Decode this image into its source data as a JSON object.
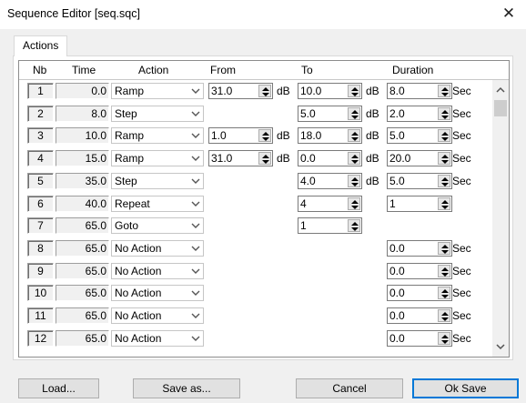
{
  "window": {
    "title": "Sequence Editor [seq.sqc]",
    "close_glyph": "✕"
  },
  "tabs": [
    {
      "label": "Actions"
    }
  ],
  "columns": {
    "nb": "Nb",
    "time": "Time",
    "action": "Action",
    "from": "From",
    "to": "To",
    "duration": "Duration"
  },
  "rows": [
    {
      "nb": "1",
      "time": "0.0",
      "action": "Ramp",
      "from": "31.0",
      "from_unit": "dB",
      "to": "10.0",
      "to_unit": "dB",
      "duration": "8.0",
      "duration_unit": "Sec"
    },
    {
      "nb": "2",
      "time": "8.0",
      "action": "Step",
      "from": null,
      "from_unit": null,
      "to": "5.0",
      "to_unit": "dB",
      "duration": "2.0",
      "duration_unit": "Sec"
    },
    {
      "nb": "3",
      "time": "10.0",
      "action": "Ramp",
      "from": "1.0",
      "from_unit": "dB",
      "to": "18.0",
      "to_unit": "dB",
      "duration": "5.0",
      "duration_unit": "Sec"
    },
    {
      "nb": "4",
      "time": "15.0",
      "action": "Ramp",
      "from": "31.0",
      "from_unit": "dB",
      "to": "0.0",
      "to_unit": "dB",
      "duration": "20.0",
      "duration_unit": "Sec"
    },
    {
      "nb": "5",
      "time": "35.0",
      "action": "Step",
      "from": null,
      "from_unit": null,
      "to": "4.0",
      "to_unit": "dB",
      "duration": "5.0",
      "duration_unit": "Sec"
    },
    {
      "nb": "6",
      "time": "40.0",
      "action": "Repeat",
      "from": null,
      "from_unit": null,
      "to": "4",
      "to_unit": null,
      "duration": "1",
      "duration_unit": null
    },
    {
      "nb": "7",
      "time": "65.0",
      "action": "Goto",
      "from": null,
      "from_unit": null,
      "to": "1",
      "to_unit": null,
      "duration": null,
      "duration_unit": null
    },
    {
      "nb": "8",
      "time": "65.0",
      "action": "No Action",
      "from": null,
      "from_unit": null,
      "to": null,
      "to_unit": null,
      "duration": "0.0",
      "duration_unit": "Sec"
    },
    {
      "nb": "9",
      "time": "65.0",
      "action": "No Action",
      "from": null,
      "from_unit": null,
      "to": null,
      "to_unit": null,
      "duration": "0.0",
      "duration_unit": "Sec"
    },
    {
      "nb": "10",
      "time": "65.0",
      "action": "No Action",
      "from": null,
      "from_unit": null,
      "to": null,
      "to_unit": null,
      "duration": "0.0",
      "duration_unit": "Sec"
    },
    {
      "nb": "11",
      "time": "65.0",
      "action": "No Action",
      "from": null,
      "from_unit": null,
      "to": null,
      "to_unit": null,
      "duration": "0.0",
      "duration_unit": "Sec"
    },
    {
      "nb": "12",
      "time": "65.0",
      "action": "No Action",
      "from": null,
      "from_unit": null,
      "to": null,
      "to_unit": null,
      "duration": "0.0",
      "duration_unit": "Sec"
    }
  ],
  "buttons": {
    "load": "Load...",
    "save_as": "Save as...",
    "cancel": "Cancel",
    "ok_save": "Ok Save"
  },
  "icons": {
    "combo": "chevron-down-icon",
    "spin": "up-down-arrows-icon",
    "scroll_up": "chevron-up-icon",
    "scroll_down": "chevron-down-icon"
  },
  "colors": {
    "default_button_border": "#0078d7",
    "dialog_bg": "#f0f0f0",
    "scroll_thumb": "#cdcdcd"
  }
}
